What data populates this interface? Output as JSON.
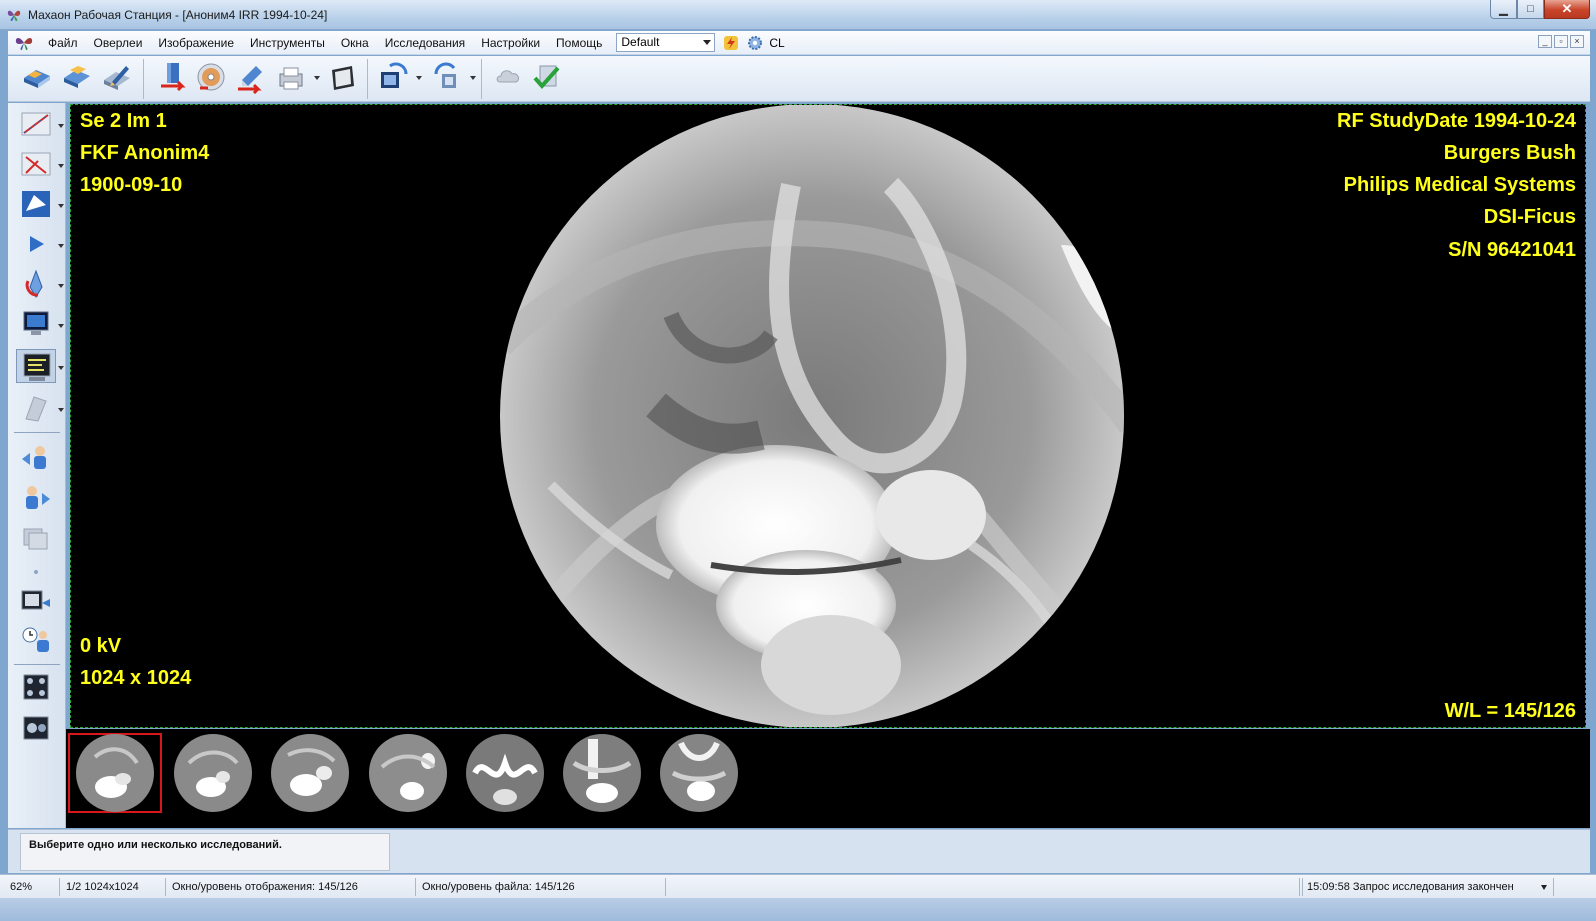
{
  "window": {
    "title": "Махаон Рабочая Станция - [Аноним4 IRR 1994-10-24]",
    "controls": {
      "minimize": "▁",
      "maximize": "□",
      "close": "✕"
    }
  },
  "menu": {
    "items": [
      "Файл",
      "Оверлеи",
      "Изображение",
      "Инструменты",
      "Окна",
      "Исследования",
      "Настройки",
      "Помощь"
    ],
    "preset": "Default",
    "cl_label": "CL",
    "mdi": {
      "minimize": "_",
      "restore": "▫",
      "close": "×"
    }
  },
  "overlay": {
    "top_left": [
      "Se 2 Im 1",
      "FKF Anonim4",
      "1900-09-10"
    ],
    "bottom_left": [
      "0 kV",
      "1024 x 1024"
    ],
    "top_right": [
      "RF StudyDate 1994-10-24",
      "Burgers Bush",
      "Philips Medical Systems",
      "DSI-Ficus",
      "S/N 96421041"
    ],
    "bottom_right": "W/L = 145/126",
    "text_color": "#ffff1a"
  },
  "thumbnails": {
    "count": 7,
    "selected_index": 0
  },
  "message": "Выберите одно или несколько исследований.",
  "status": {
    "zoom": "62%",
    "image_info": "1/2 1024x1024",
    "display_wl": "Окно/уровень отображения: 145/126",
    "file_wl": "Окно/уровень файла: 145/126",
    "query_status": "15:09:58 Запрос исследования закончен"
  }
}
